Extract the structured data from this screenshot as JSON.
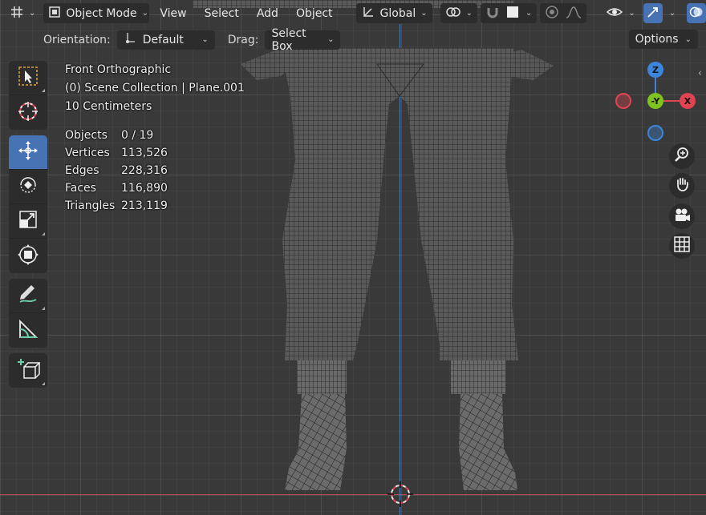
{
  "header": {
    "mode": "Object Mode",
    "menus": [
      "View",
      "Select",
      "Add",
      "Object"
    ],
    "transform_orientation": "Global"
  },
  "subheader": {
    "orientation_label": "Orientation:",
    "orientation_value": "Default",
    "drag_label": "Drag:",
    "drag_value": "Select Box",
    "options_label": "Options"
  },
  "overlay": {
    "view_name": "Front Orthographic",
    "collection": "(0) Scene Collection | Plane.001",
    "scale": "10 Centimeters",
    "stats": [
      {
        "key": "Objects",
        "value": "0 / 19"
      },
      {
        "key": "Vertices",
        "value": "113,526"
      },
      {
        "key": "Edges",
        "value": "228,316"
      },
      {
        "key": "Faces",
        "value": "116,890"
      },
      {
        "key": "Triangles",
        "value": "213,119"
      }
    ]
  },
  "gizmo": {
    "z_label": "Z",
    "y_label": "-Y",
    "x_label": "X",
    "colors": {
      "x": "#e04452",
      "y": "#7fc31f",
      "z": "#3b86dc"
    }
  },
  "colors": {
    "accent": "#4772b3",
    "axis_x": "#b04b55",
    "axis_z": "#4d7fc4",
    "panel": "#2c2c2c",
    "viewport": "#393939"
  }
}
